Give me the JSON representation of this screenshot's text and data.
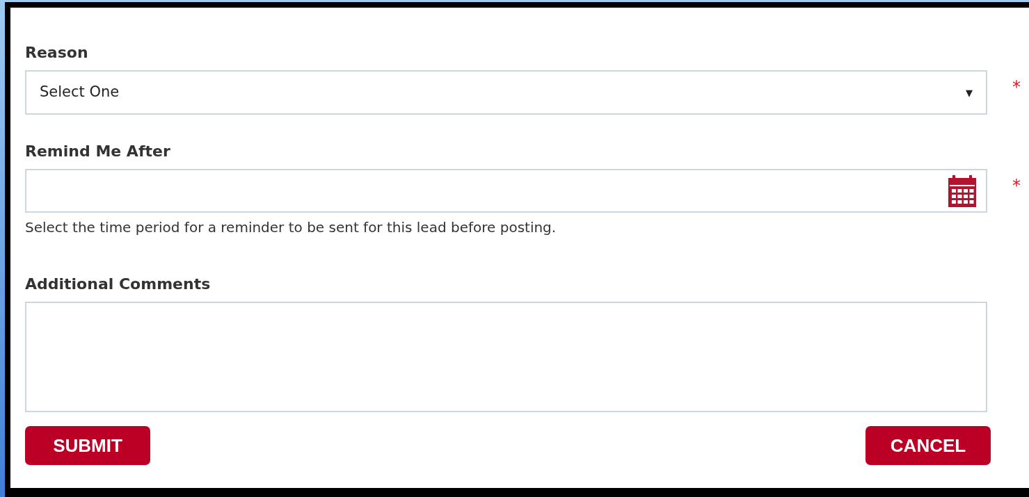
{
  "fields": [
    {
      "kind": "select",
      "label": "Reason",
      "value": "Select One",
      "arrow": "▾",
      "required_mark": "*"
    },
    {
      "kind": "date",
      "label": "Remind Me After",
      "required_mark": "*",
      "help": "Select the time period for a reminder to be sent for this lead before posting."
    },
    {
      "kind": "textarea",
      "label": "Additional Comments"
    }
  ],
  "buttons": [
    {
      "label": "SUBMIT"
    },
    {
      "label": "CANCEL"
    }
  ]
}
